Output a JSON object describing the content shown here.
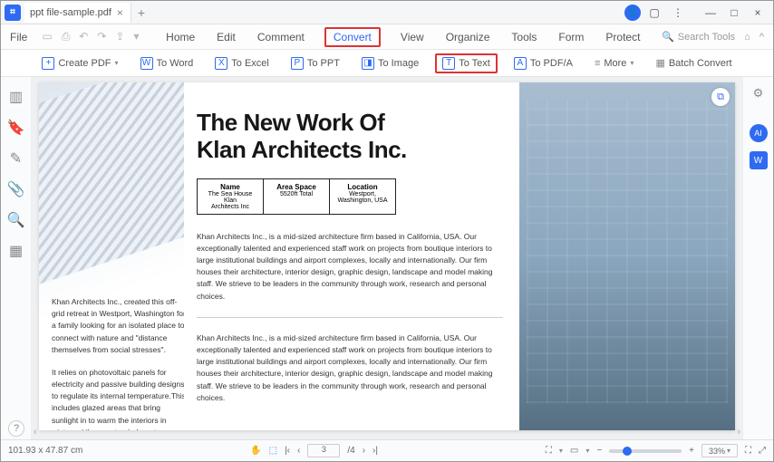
{
  "titlebar": {
    "tab_name": "ppt file-sample.pdf"
  },
  "menubar": {
    "file": "File",
    "items": [
      "Home",
      "Edit",
      "Comment",
      "Convert",
      "View",
      "Organize",
      "Tools",
      "Form",
      "Protect"
    ],
    "active": "Convert",
    "search_placeholder": "Search Tools"
  },
  "toolbar": {
    "create_pdf": "Create PDF",
    "to_word": "To Word",
    "to_excel": "To Excel",
    "to_ppt": "To PPT",
    "to_image": "To Image",
    "to_text": "To Text",
    "to_pdfa": "To PDF/A",
    "more": "More",
    "batch": "Batch Convert"
  },
  "document": {
    "headline_l1": "The New Work Of",
    "headline_l2": "Klan Architects Inc.",
    "table": {
      "h1": "Name",
      "v1a": "The Sea House Klan",
      "v1b": "Architects Inc",
      "h2": "Area Space",
      "v2": "5520ft Total",
      "h3": "Location",
      "v3a": "Westport,",
      "v3b": "Washington, USA"
    },
    "left_p1": "Khan Architects Inc., created this off-grid retreat in Westport, Washington for a family looking for an isolated place to connect with nature and \"distance themselves from social stresses\".",
    "left_p2": "It relies on photovoltaic panels for electricity and passive building designs to regulate its internal temperature.This includes glazed areas that bring sunlight in to warm the interiors in winter, while an extended west-facingroof provides shade from solar heat during evenings in the summer.",
    "body_p": "Khan Architects Inc., is a mid-sized architecture firm based in California, USA. Our exceptionally talented and experienced staff work on projects from boutique interiors to large institutional buildings and airport complexes, locally and internationally. Our firm houses their architecture, interior design, graphic design, landscape and model making staff. We strieve to be leaders in the community through work, research and personal choices."
  },
  "statusbar": {
    "dimensions": "101.93 x 47.87 cm",
    "page": "3",
    "total": "/4",
    "zoom": "33%"
  }
}
